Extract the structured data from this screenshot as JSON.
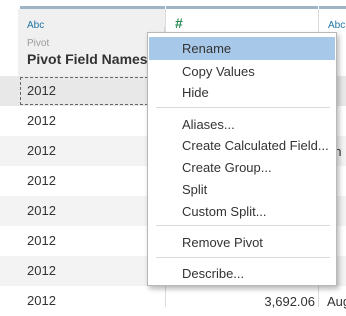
{
  "columns": [
    {
      "type_icon": "Abc",
      "sub_label": "Pivot",
      "name": "Pivot Field Names"
    },
    {
      "type_icon": "#"
    },
    {
      "type_icon": "Abc"
    }
  ],
  "rows": [
    {
      "year": "2012",
      "value": "",
      "edge": ""
    },
    {
      "year": "2012",
      "value": "",
      "edge": ""
    },
    {
      "year": "2012",
      "value": "",
      "edge": "an"
    },
    {
      "year": "2012",
      "value": "",
      "edge": ""
    },
    {
      "year": "2012",
      "value": "",
      "edge": "y"
    },
    {
      "year": "2012",
      "value": "",
      "edge": ""
    },
    {
      "year": "2012",
      "value": "",
      "edge": "ly"
    },
    {
      "year": "2012",
      "value": "3,692.06",
      "edge": "Aug"
    }
  ],
  "context_menu": {
    "items": [
      {
        "label": "Rename",
        "highlighted": true
      },
      {
        "label": "Copy Values"
      },
      {
        "label": "Hide"
      },
      {
        "label": "Aliases..."
      },
      {
        "label": "Create Calculated Field..."
      },
      {
        "label": "Create Group..."
      },
      {
        "label": "Split"
      },
      {
        "label": "Custom Split..."
      },
      {
        "label": "Remove Pivot"
      },
      {
        "label": "Describe..."
      }
    ]
  },
  "colors": {
    "highlight": "#a8c8ea",
    "string_type": "#1f74a4",
    "number_type": "#2e8b57"
  }
}
